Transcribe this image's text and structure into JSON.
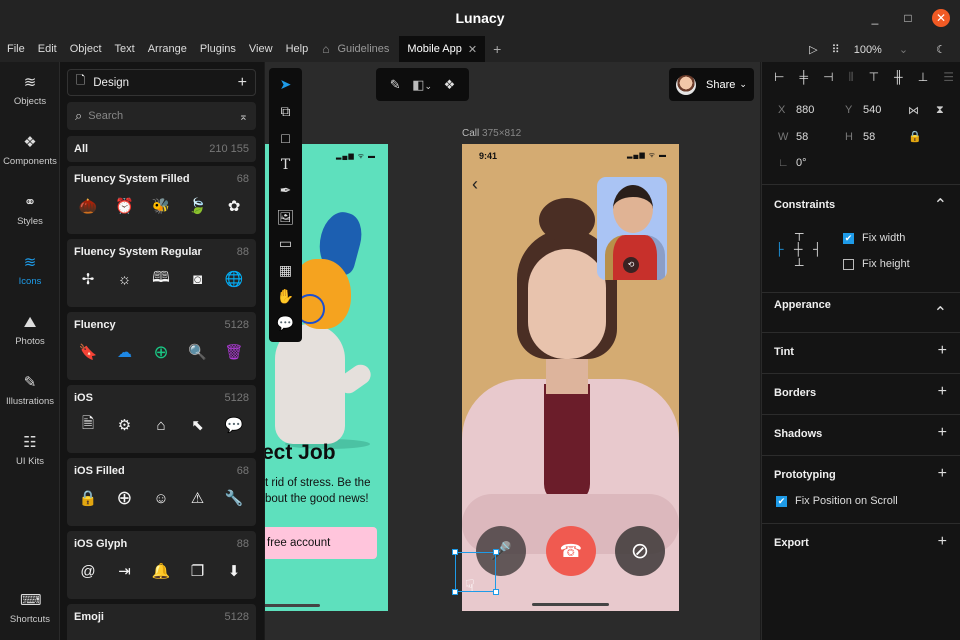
{
  "window": {
    "title": "Lunacy",
    "minimize_icon": "_",
    "maximize_icon": "□",
    "close_icon": "✕"
  },
  "menu": {
    "items": [
      "File",
      "Edit",
      "Object",
      "Text",
      "Arrange",
      "Plugins",
      "View",
      "Help"
    ],
    "home_icon": "⌂",
    "tabs": [
      {
        "label": "Guidelines",
        "active": false
      },
      {
        "label": "Mobile App",
        "active": true
      }
    ],
    "tab_close": "✕",
    "new_tab": "+",
    "play_icon": "▷",
    "grid_icon": "⠿",
    "zoom": "100%",
    "zoom_chevron": "⌄",
    "theme_icon": "☾"
  },
  "rail": {
    "items": [
      {
        "label": "Objects",
        "icon": "≋",
        "active": false
      },
      {
        "label": "Components",
        "icon": "❖",
        "active": false
      },
      {
        "label": "Styles",
        "icon": "⚭",
        "active": false
      },
      {
        "label": "Icons",
        "icon": "≋",
        "active": true
      },
      {
        "label": "Photos",
        "icon": "⛰",
        "active": false
      },
      {
        "label": "Illustrations",
        "icon": "✎",
        "active": false
      },
      {
        "label": "UI Kits",
        "icon": "☷",
        "active": false
      },
      {
        "label": "Shortcuts",
        "icon": "⌨",
        "active": false
      }
    ]
  },
  "library": {
    "document": "Design",
    "add": "+",
    "search_placeholder": "Search",
    "search_icon": "⌕",
    "collapse_icon": "⌅",
    "all": {
      "label": "All",
      "count": "210 155"
    },
    "sets": [
      {
        "name": "Fluency System Filled",
        "count": "68",
        "icons": [
          "acorn",
          "alarm-clock",
          "bee",
          "leaf",
          "flower"
        ],
        "glyphs": [
          "🌰",
          "⏰",
          "🐝",
          "🍃",
          "✿"
        ]
      },
      {
        "name": "Fluency System Regular",
        "count": "88",
        "icons": [
          "windmill",
          "solar-panel",
          "book",
          "document-disc",
          "globe"
        ],
        "glyphs": [
          "✢",
          "☼",
          "🕮",
          "◙",
          "🌐"
        ]
      },
      {
        "name": "Fluency",
        "count": "5128",
        "icons": [
          "bookmark-add",
          "cloud-download",
          "add-circle",
          "search",
          "trash"
        ],
        "glyphs": [
          "🔖",
          "☁",
          "⊕",
          "🔍",
          "🗑"
        ],
        "colors": [
          "#e8344a",
          "#1e88e5",
          "#19c784",
          "#2ecbe8",
          "#b03ad8"
        ]
      },
      {
        "name": "iOS",
        "count": "5128",
        "icons": [
          "document",
          "settings",
          "home",
          "cursor",
          "chat-bubble"
        ],
        "glyphs": [
          "🗎",
          "⚙",
          "⌂",
          "⬉",
          "💬"
        ]
      },
      {
        "name": "iOS Filled",
        "count": "68",
        "icons": [
          "lock",
          "add-circle",
          "face-id",
          "warning",
          "wrench"
        ],
        "glyphs": [
          "🔒",
          "⊕",
          "☺",
          "⚠",
          "🔧"
        ]
      },
      {
        "name": "iOS Glyph",
        "count": "88",
        "icons": [
          "at-sign",
          "sign-in",
          "bell",
          "copy",
          "download-circle"
        ],
        "glyphs": [
          "@",
          "⇥",
          "🔔",
          "❐",
          "⬇"
        ]
      },
      {
        "name": "Emoji",
        "count": "5128",
        "icons": [],
        "glyphs": []
      }
    ]
  },
  "canvas": {
    "tools": [
      {
        "name": "select",
        "glyph": "➤",
        "active": true
      },
      {
        "name": "frame",
        "glyph": "⧉",
        "active": false
      },
      {
        "name": "rectangle",
        "glyph": "□",
        "active": false
      },
      {
        "name": "text",
        "glyph": "T",
        "active": false
      },
      {
        "name": "pen",
        "glyph": "✒",
        "active": false
      },
      {
        "name": "image",
        "glyph": "🖼",
        "active": false
      },
      {
        "name": "component",
        "glyph": "▭",
        "active": false
      },
      {
        "name": "grid",
        "glyph": "▦",
        "active": false
      },
      {
        "name": "hand",
        "glyph": "✋",
        "active": false
      },
      {
        "name": "comment",
        "glyph": "💬",
        "active": false
      }
    ],
    "float_bar": {
      "edit_icon": "✎",
      "boolean_icon": "◧",
      "chevron": "⌄",
      "component_icon": "❖"
    },
    "share": {
      "label": "Share",
      "chevron": "⌄"
    },
    "frame_label": {
      "name": "Call",
      "size": "375×812"
    },
    "teal_screen": {
      "status": "▂▄▆ ᯤ ▬",
      "headline": "ect Job",
      "body_line1": "t rid of stress. Be the",
      "body_line2": "bout the good news!",
      "cta": "free account"
    },
    "call_screen": {
      "time": "9:41",
      "status": "▂▄▆ ᯤ ▬",
      "back": "‹",
      "swap_icon": "⟲",
      "mute_icon": "🎤",
      "end_icon": "☎",
      "camera_off_icon": "⊘"
    },
    "hand_cursor": "☟"
  },
  "inspector": {
    "align_icons": [
      "⊢",
      "╪",
      "⊣",
      "⫴",
      "⊤",
      "╫",
      "⊥",
      "☰"
    ],
    "x": {
      "label": "X",
      "value": "880"
    },
    "y": {
      "label": "Y",
      "value": "540"
    },
    "w": {
      "label": "W",
      "value": "58"
    },
    "h": {
      "label": "H",
      "value": "58"
    },
    "rotation": {
      "label": "∟",
      "value": "0°"
    },
    "flip_h_icon": "⋈",
    "flip_v_icon": "⧗",
    "lock_icon": "🔒",
    "constraints": {
      "title": "Constraints",
      "toggle": "⌃",
      "fix_width": {
        "label": "Fix width",
        "checked": true
      },
      "fix_height": {
        "label": "Fix height",
        "checked": false
      }
    },
    "appearance": {
      "title": "Apperance",
      "toggle": "⌃"
    },
    "tint": {
      "title": "Tint",
      "action": "+"
    },
    "borders": {
      "title": "Borders",
      "action": "+"
    },
    "shadows": {
      "title": "Shadows",
      "action": "+"
    },
    "prototyping": {
      "title": "Prototyping",
      "action": "+",
      "fix_position": {
        "label": "Fix Position on Scroll",
        "checked": true
      }
    },
    "export": {
      "title": "Export",
      "action": "+"
    },
    "check_mark": "✔"
  }
}
